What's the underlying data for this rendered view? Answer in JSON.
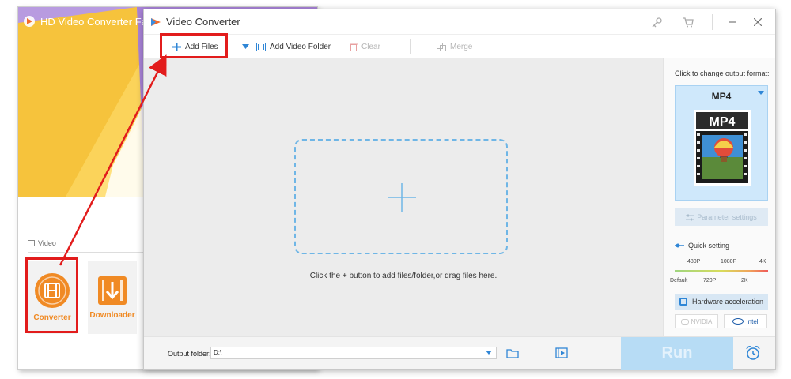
{
  "launcher": {
    "title": "HD Video Converter Factory P",
    "section_label": "Video",
    "tools": [
      {
        "label": "Converter",
        "icon": "film-reel-icon"
      },
      {
        "label": "Downloader",
        "icon": "download-icon"
      }
    ]
  },
  "main": {
    "title": "Video Converter",
    "title_icons": [
      "key-icon",
      "cart-icon",
      "minimize-icon",
      "close-icon"
    ],
    "toolbar": {
      "add_files": "Add Files",
      "add_video_folder": "Add Video Folder",
      "clear": "Clear",
      "merge": "Merge"
    },
    "drop_hint": "Click the + button to add files/folder,or drag files here.",
    "side_panel": {
      "format_caption": "Click to change output format:",
      "format_name": "MP4",
      "format_badge": "MP4",
      "parameter_settings": "Parameter settings",
      "quick_setting": "Quick setting",
      "quality_top": [
        "480P",
        "1080P",
        "4K"
      ],
      "quality_bottom": [
        "Default",
        "720P",
        "2K"
      ],
      "hardware_acceleration": "Hardware acceleration",
      "gpu_options": [
        "NVIDIA",
        "Intel"
      ]
    },
    "bottom": {
      "output_folder_label": "Output folder:",
      "output_folder_value": "D:\\",
      "run": "Run"
    }
  },
  "colors": {
    "highlight": "#e21c1c",
    "accent": "#2f86d6",
    "orange": "#f08a24"
  }
}
